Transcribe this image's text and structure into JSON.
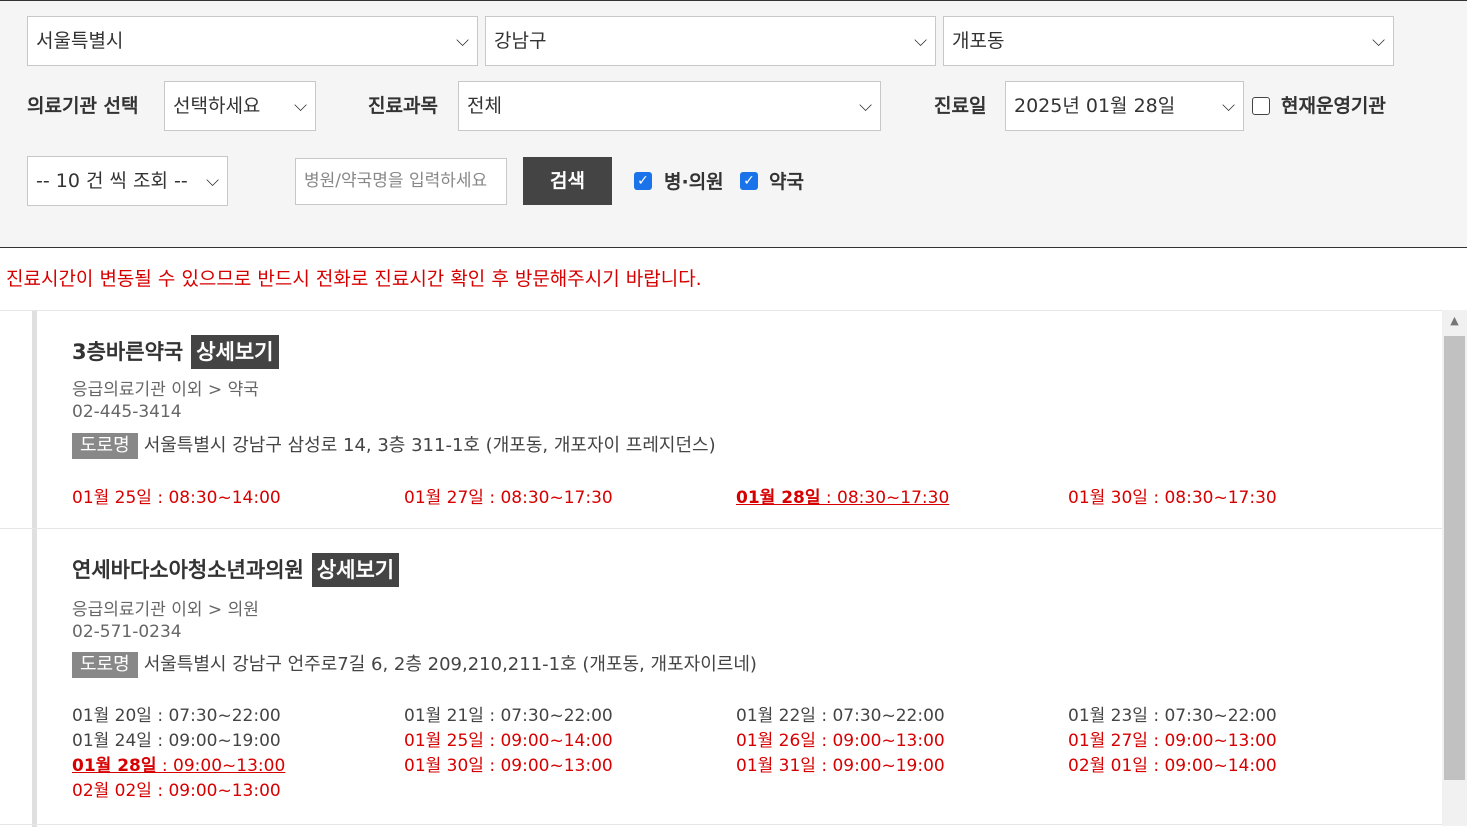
{
  "filters": {
    "city": "서울특별시",
    "district": "강남구",
    "dong": "개포동",
    "institution_label": "의료기관 선택",
    "institution_value": "선택하세요",
    "dept_label": "진료과목",
    "dept_value": "전체",
    "date_label": "진료일",
    "date_value": "2025년 01월 28일",
    "operating_label": "현재운영기관",
    "page_size": "-- 10 건 씩 조회 --",
    "search_placeholder": "병원/약국명을 입력하세요",
    "search_button": "검색",
    "hospital_label": "병·의원",
    "pharmacy_label": "약국"
  },
  "notice": "진료시간이 변동될 수 있으므로 반드시 전화로 진료시간 확인 후 방문해주시기 바랍니다.",
  "detail_label": "상세보기",
  "road_tag": "도로명",
  "results": [
    {
      "name": "3층바른약국",
      "category": "응급의료기관 이외 > 약국",
      "phone": "02-445-3414",
      "address": "서울특별시 강남구 삼성로 14, 3층 311-1호 (개포동, 개포자이 프레지던스)",
      "hours": [
        {
          "date": "01월 25일",
          "time": " : 08:30~14:00",
          "style": "red"
        },
        {
          "date": "01월 27일",
          "time": " : 08:30~17:30",
          "style": "red"
        },
        {
          "date": "01월 28일",
          "time": " : 08:30~17:30",
          "style": "today"
        },
        {
          "date": "01월 30일",
          "time": " : 08:30~17:30",
          "style": "red"
        }
      ]
    },
    {
      "name": "연세바다소아청소년과의원",
      "category": "응급의료기관 이외 > 의원",
      "phone": "02-571-0234",
      "address": "서울특별시 강남구 언주로7길 6, 2층 209,210,211-1호 (개포동, 개포자이르네)",
      "hours": [
        {
          "date": "01월 20일",
          "time": " : 07:30~22:00",
          "style": "dark"
        },
        {
          "date": "01월 21일",
          "time": " : 07:30~22:00",
          "style": "dark"
        },
        {
          "date": "01월 22일",
          "time": " : 07:30~22:00",
          "style": "dark"
        },
        {
          "date": "01월 23일",
          "time": " : 07:30~22:00",
          "style": "dark"
        },
        {
          "date": "01월 24일",
          "time": " : 09:00~19:00",
          "style": "dark"
        },
        {
          "date": "01월 25일",
          "time": " : 09:00~14:00",
          "style": "red"
        },
        {
          "date": "01월 26일",
          "time": " : 09:00~13:00",
          "style": "red"
        },
        {
          "date": "01월 27일",
          "time": " : 09:00~13:00",
          "style": "red"
        },
        {
          "date": "01월 28일",
          "time": " : 09:00~13:00",
          "style": "today"
        },
        {
          "date": "01월 30일",
          "time": " : 09:00~13:00",
          "style": "red"
        },
        {
          "date": "01월 31일",
          "time": " : 09:00~19:00",
          "style": "red"
        },
        {
          "date": "02월 01일",
          "time": " : 09:00~14:00",
          "style": "red"
        },
        {
          "date": "02월 02일",
          "time": " : 09:00~13:00",
          "style": "red"
        }
      ]
    }
  ],
  "icons": {
    "dropdown": "chevron-down-icon",
    "check": "check-icon",
    "scroll_up": "scroll-up-arrow-icon"
  }
}
